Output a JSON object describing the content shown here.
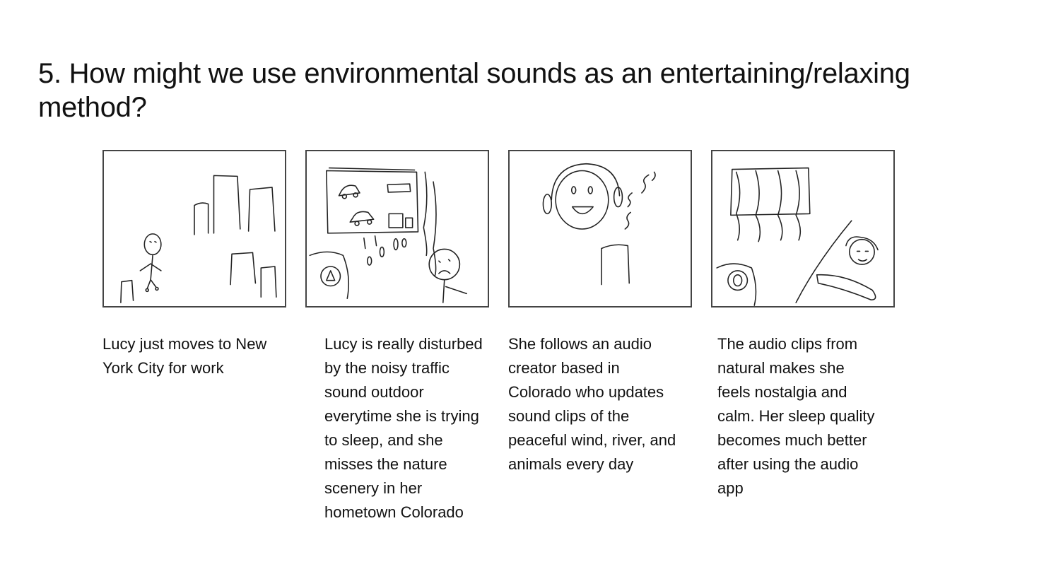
{
  "slide": {
    "title": "5. How might we use environmental sounds as an entertaining/relaxing method?"
  },
  "storyboard": {
    "panels": [
      {
        "sketch": "person-in-city-sketch",
        "caption": "Lucy just moves to New York City for work"
      },
      {
        "sketch": "noisy-traffic-sketch",
        "caption": "Lucy is really disturbed by the noisy traffic sound outdoor everytime she is trying to sleep, and she misses the nature scenery in her hometown Colorado"
      },
      {
        "sketch": "audio-creator-sketch",
        "caption": "She follows an audio creator based in Colorado who updates sound clips of the peaceful wind, river, and animals every day"
      },
      {
        "sketch": "relaxing-sleep-sketch",
        "caption": "The audio clips from natural makes she feels nostalgia and calm. Her sleep quality becomes much better after using the audio app"
      }
    ]
  }
}
